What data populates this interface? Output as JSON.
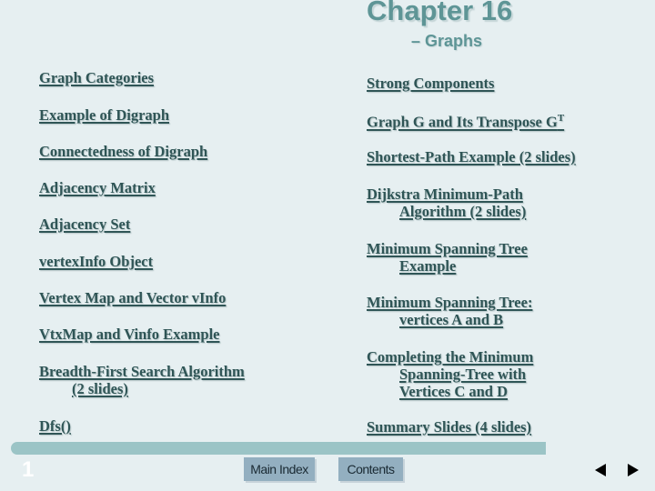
{
  "header": {
    "title": "Chapter 16",
    "subtitle": "– Graphs"
  },
  "left_links": [
    {
      "line1": "Graph Categories"
    },
    {
      "line1": "Example of  Digraph"
    },
    {
      "line1": "Connectedness of Digraph"
    },
    {
      "line1": "Adjacency Matrix"
    },
    {
      "line1": "Adjacency Set"
    },
    {
      "line1": "vertexInfo Object"
    },
    {
      "line1": "Vertex Map and Vector vInfo"
    },
    {
      "line1": "VtxMap and Vinfo Example"
    },
    {
      "line1": "Breadth-First Search Algorithm",
      "line2": "(2 slides)"
    },
    {
      "line1": "Dfs()"
    }
  ],
  "right_links": [
    {
      "line1": "Strong Components"
    },
    {
      "line1": "Graph G and Its Transpose G",
      "sup": "T"
    },
    {
      "line1": "Shortest-Path Example (2 slides)"
    },
    {
      "line1": "Dijkstra Minimum-Path",
      "line2": "Algorithm  (2 slides)"
    },
    {
      "line1": "Minimum Spanning Tree",
      "line2": "Example"
    },
    {
      "line1": "Minimum Spanning Tree:",
      "line2": "vertices A and B"
    },
    {
      "line1": "Completing the Minimum",
      "line2": "Spanning-Tree with",
      "line3": "Vertices C and D"
    },
    {
      "line1": "Summary Slides (4 slides)"
    }
  ],
  "footer": {
    "page_number": "1",
    "main_index_label": "Main Index",
    "contents_label": "Contents",
    "prev_icon": "triangle-left",
    "next_icon": "triangle-right"
  },
  "colors": {
    "background": "#e6eff1",
    "title": "#5e9596",
    "link": "#2f5556",
    "bar": "#9bc4c6",
    "nav_button": "#93afc0"
  }
}
